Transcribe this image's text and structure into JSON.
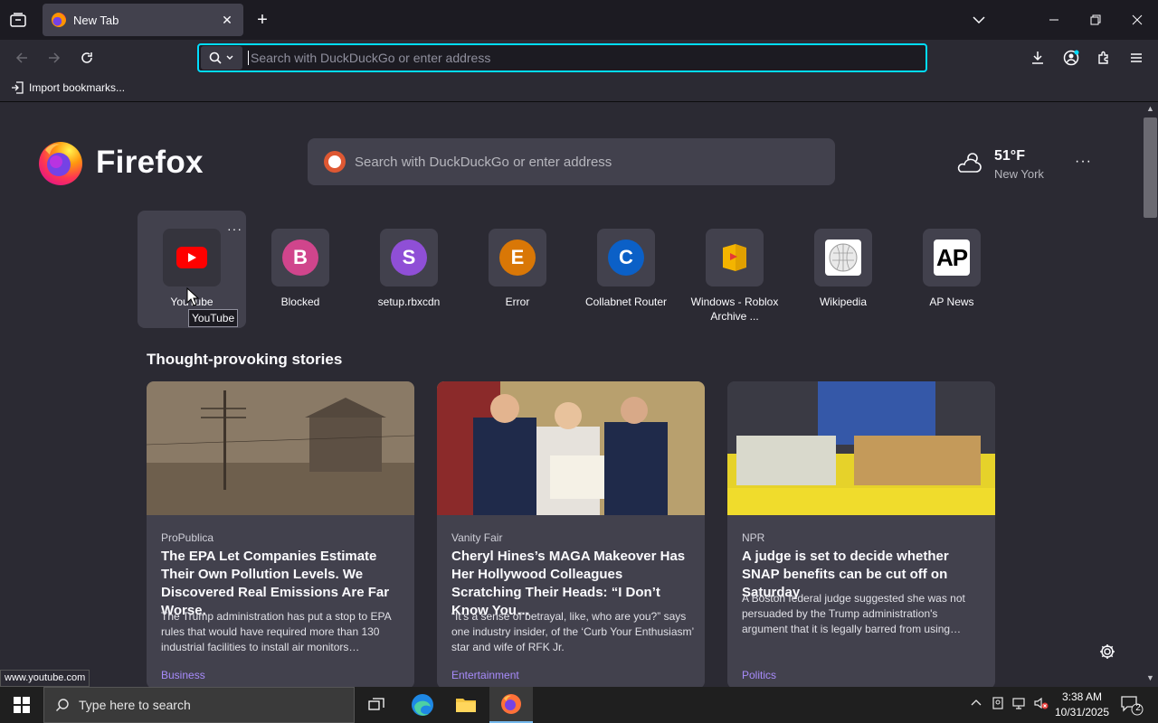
{
  "browser": {
    "tab": {
      "title": "New Tab"
    },
    "urlbar": {
      "placeholder": "Search with DuckDuckGo or enter address"
    },
    "bookmarks": {
      "import_label": "Import bookmarks..."
    }
  },
  "newtab": {
    "wordmark": "Firefox",
    "search_placeholder": "Search with DuckDuckGo or enter address",
    "weather": {
      "temp": "51°F",
      "city": "New York",
      "icon": "cloudy-icon"
    },
    "shortcuts": [
      {
        "label": "YouTube",
        "letter": "",
        "color": "#ff0000",
        "icon": "youtube-icon"
      },
      {
        "label": "Blocked",
        "letter": "B",
        "color": "#d0458c"
      },
      {
        "label": "setup.rbxcdn",
        "letter": "S",
        "color": "#8f4fd6"
      },
      {
        "label": "Error",
        "letter": "E",
        "color": "#d97706"
      },
      {
        "label": "Collabnet Router",
        "letter": "C",
        "color": "#0b60c7"
      },
      {
        "label": "Windows - Roblox Archive ...",
        "letter": "",
        "color": "#f4b400",
        "icon": "folder-icon"
      },
      {
        "label": "Wikipedia",
        "letter": "",
        "color": "#ffffff",
        "icon": "wikipedia-icon"
      },
      {
        "label": "AP News",
        "letter": "AP",
        "color": "#000000",
        "icon": "ap-news-icon"
      }
    ],
    "tooltip": "YouTube",
    "stories_title": "Thought-provoking stories",
    "stories": [
      {
        "source": "ProPublica",
        "headline": "The EPA Let Companies Estimate Their Own Pollution Levels. We Discovered Real Emissions Are Far Worse.",
        "excerpt": "The Trump administration has put a stop to EPA rules that would have required more than 130 industrial facilities to install air monitors…",
        "category": "Business"
      },
      {
        "source": "Vanity Fair",
        "headline": "Cheryl Hines’s MAGA Makeover Has Her Hollywood Colleagues Scratching Their Heads: “I Don’t Know You…",
        "excerpt": "“It’s a sense of betrayal, like, who are you?” says one industry insider, of the ‘Curb Your Enthusiasm’ star and wife of RFK Jr.",
        "category": "Entertainment"
      },
      {
        "source": "NPR",
        "headline": "A judge is set to decide whether SNAP benefits can be cut off on Saturday",
        "excerpt": "A Boston federal judge suggested she was not persuaded by the Trump administration's argument that it is legally barred from using…",
        "category": "Politics"
      }
    ],
    "status_url": "www.youtube.com"
  },
  "taskbar": {
    "search_placeholder": "Type here to search",
    "time": "3:38 AM",
    "date": "10/31/2025",
    "notification_count": "2"
  },
  "colors": {
    "accent": "#00ddff",
    "category": "#a78bfa"
  }
}
